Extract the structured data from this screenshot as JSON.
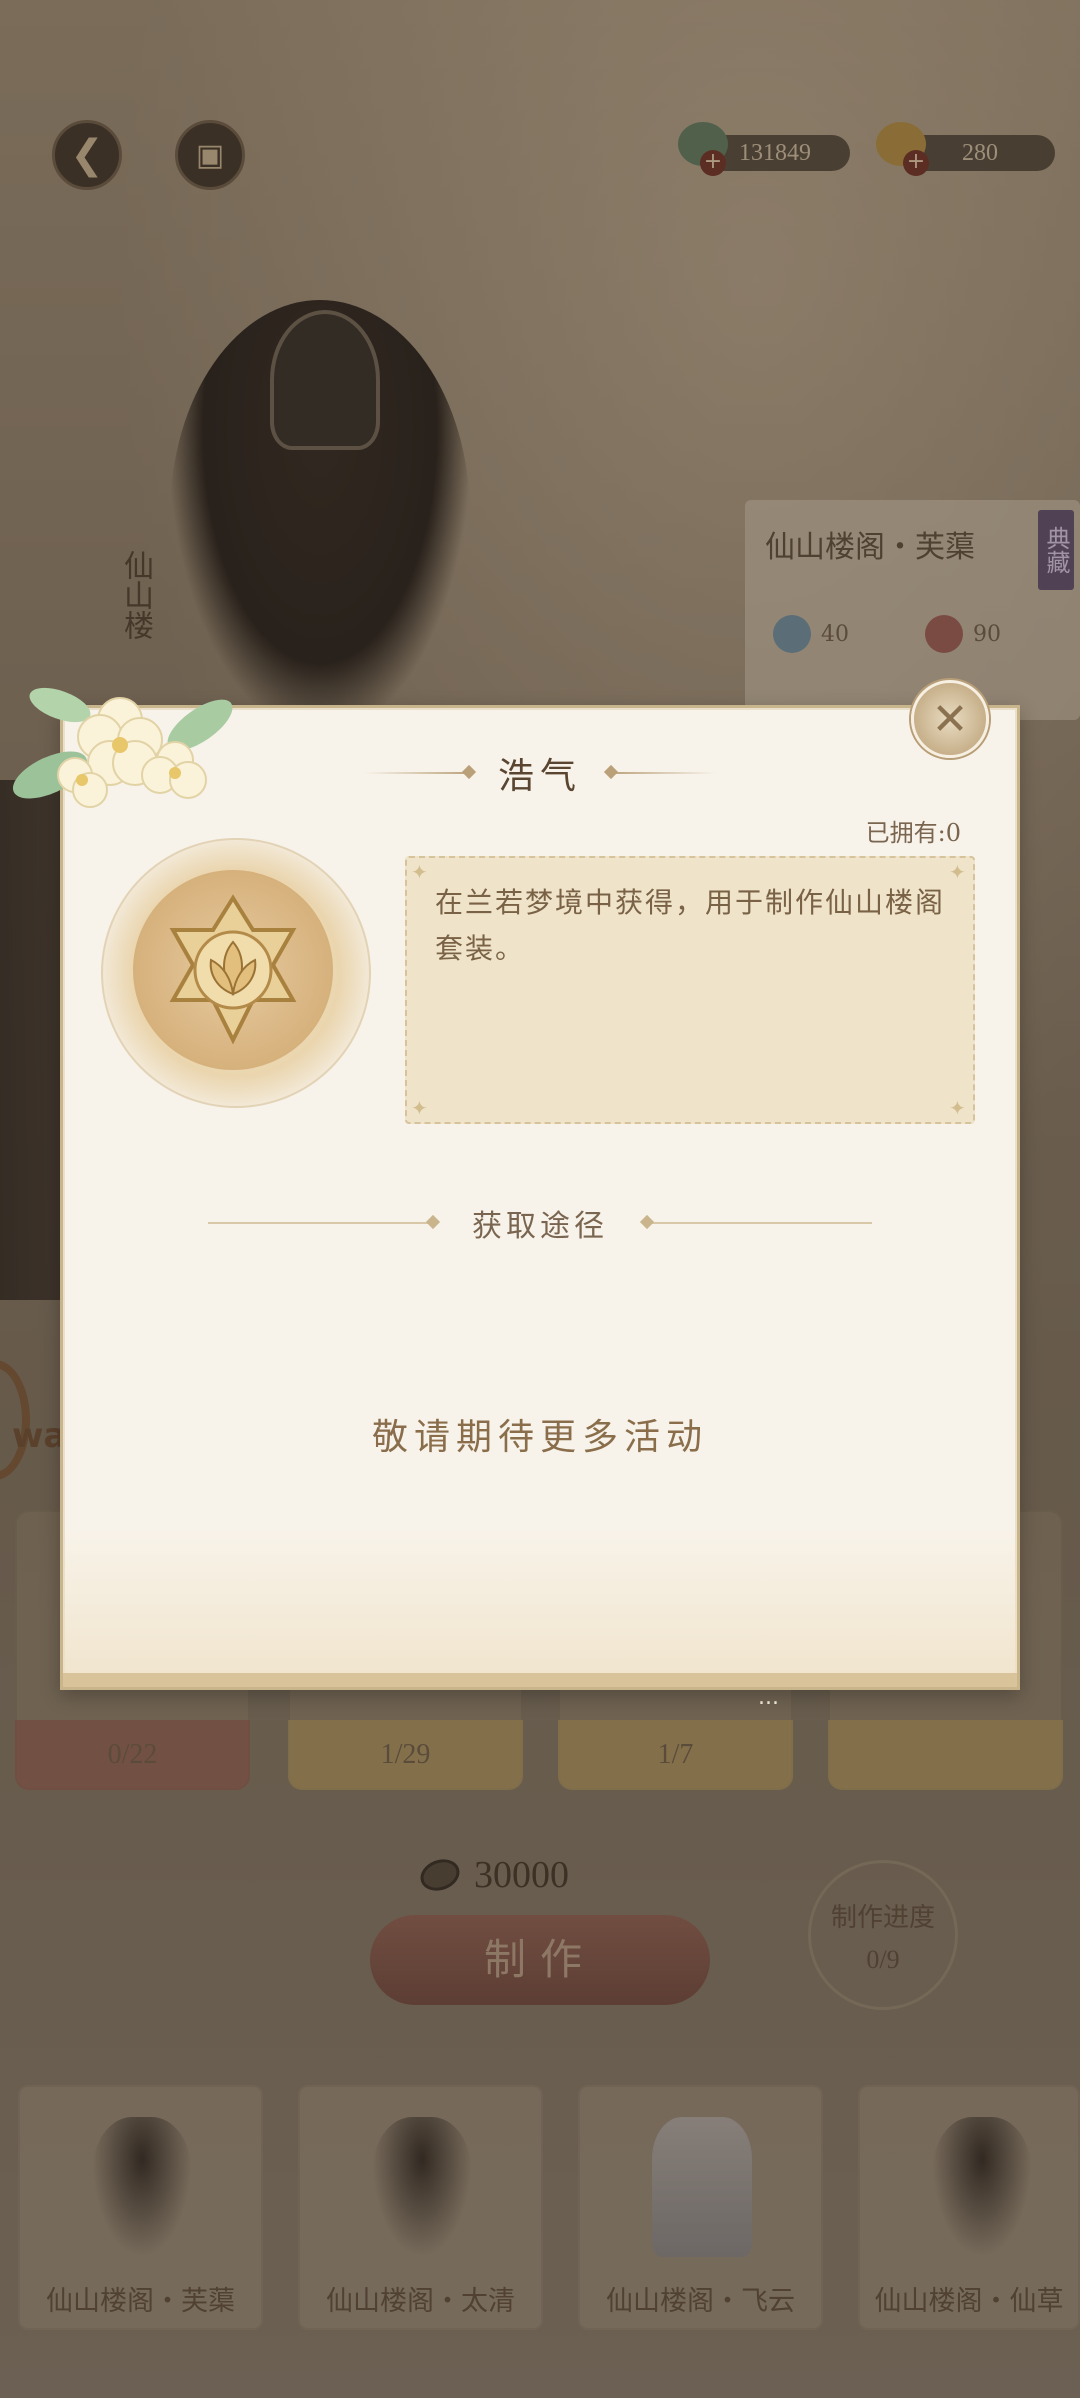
{
  "header": {
    "back_icon": "back-arrow-icon",
    "wardrobe_icon": "chest-icon",
    "currencies": [
      {
        "name": "jade",
        "value": "131849"
      },
      {
        "name": "gold-ingot",
        "value": "280"
      }
    ]
  },
  "character": {
    "side_name": "仙山楼",
    "outfit_panel": {
      "title": "仙山楼阁・芙蕖",
      "tag": "典藏",
      "stats": [
        "40",
        "90"
      ]
    }
  },
  "materials": [
    {
      "count": "0/22"
    },
    {
      "count": "1/29"
    },
    {
      "count": "1/7"
    },
    {
      "count": ""
    }
  ],
  "craft": {
    "cost": "30000",
    "button_label": "制作",
    "progress_label": "制作进度",
    "progress_value": "0/9"
  },
  "bottom_items": [
    {
      "label": "仙山楼阁・芙蕖"
    },
    {
      "label": "仙山楼阁・太清"
    },
    {
      "label": "仙山楼阁・飞云"
    },
    {
      "label": "仙山楼阁・仙草"
    }
  ],
  "watermark": {
    "text": "wan"
  },
  "modal": {
    "title": "浩气",
    "owned": "已拥有:0",
    "description": "在兰若梦境中获得，用于制作仙山楼阁套装。",
    "section_title": "获取途径",
    "empty_text": "敬请期待更多活动",
    "ellipsis": "..."
  },
  "colors": {
    "modal_bg": "#f8f3ea",
    "accent_gold": "#c9b58c",
    "make_button": "#7f5244"
  }
}
